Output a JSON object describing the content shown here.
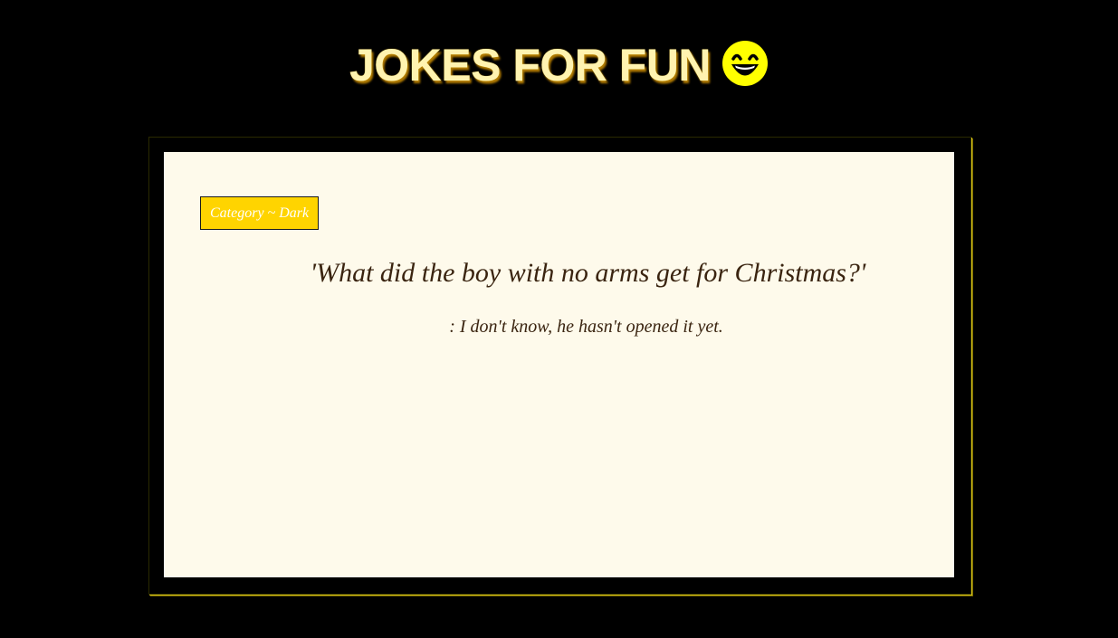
{
  "header": {
    "title": "JOKES FOR FUN",
    "emoji_icon": "grinning-face-icon",
    "emoji_color": "#ffff00"
  },
  "joke": {
    "category_label": "Category ~ Dark",
    "question": "'What did the boy with no arms get for Christmas?'",
    "answer": ": I don't know, he hasn't opened it yet."
  },
  "colors": {
    "background": "#000000",
    "card_background": "#fefaeb",
    "badge_background": "#ffd400",
    "text": "#3a2410",
    "title_text": "#fff3b0"
  }
}
